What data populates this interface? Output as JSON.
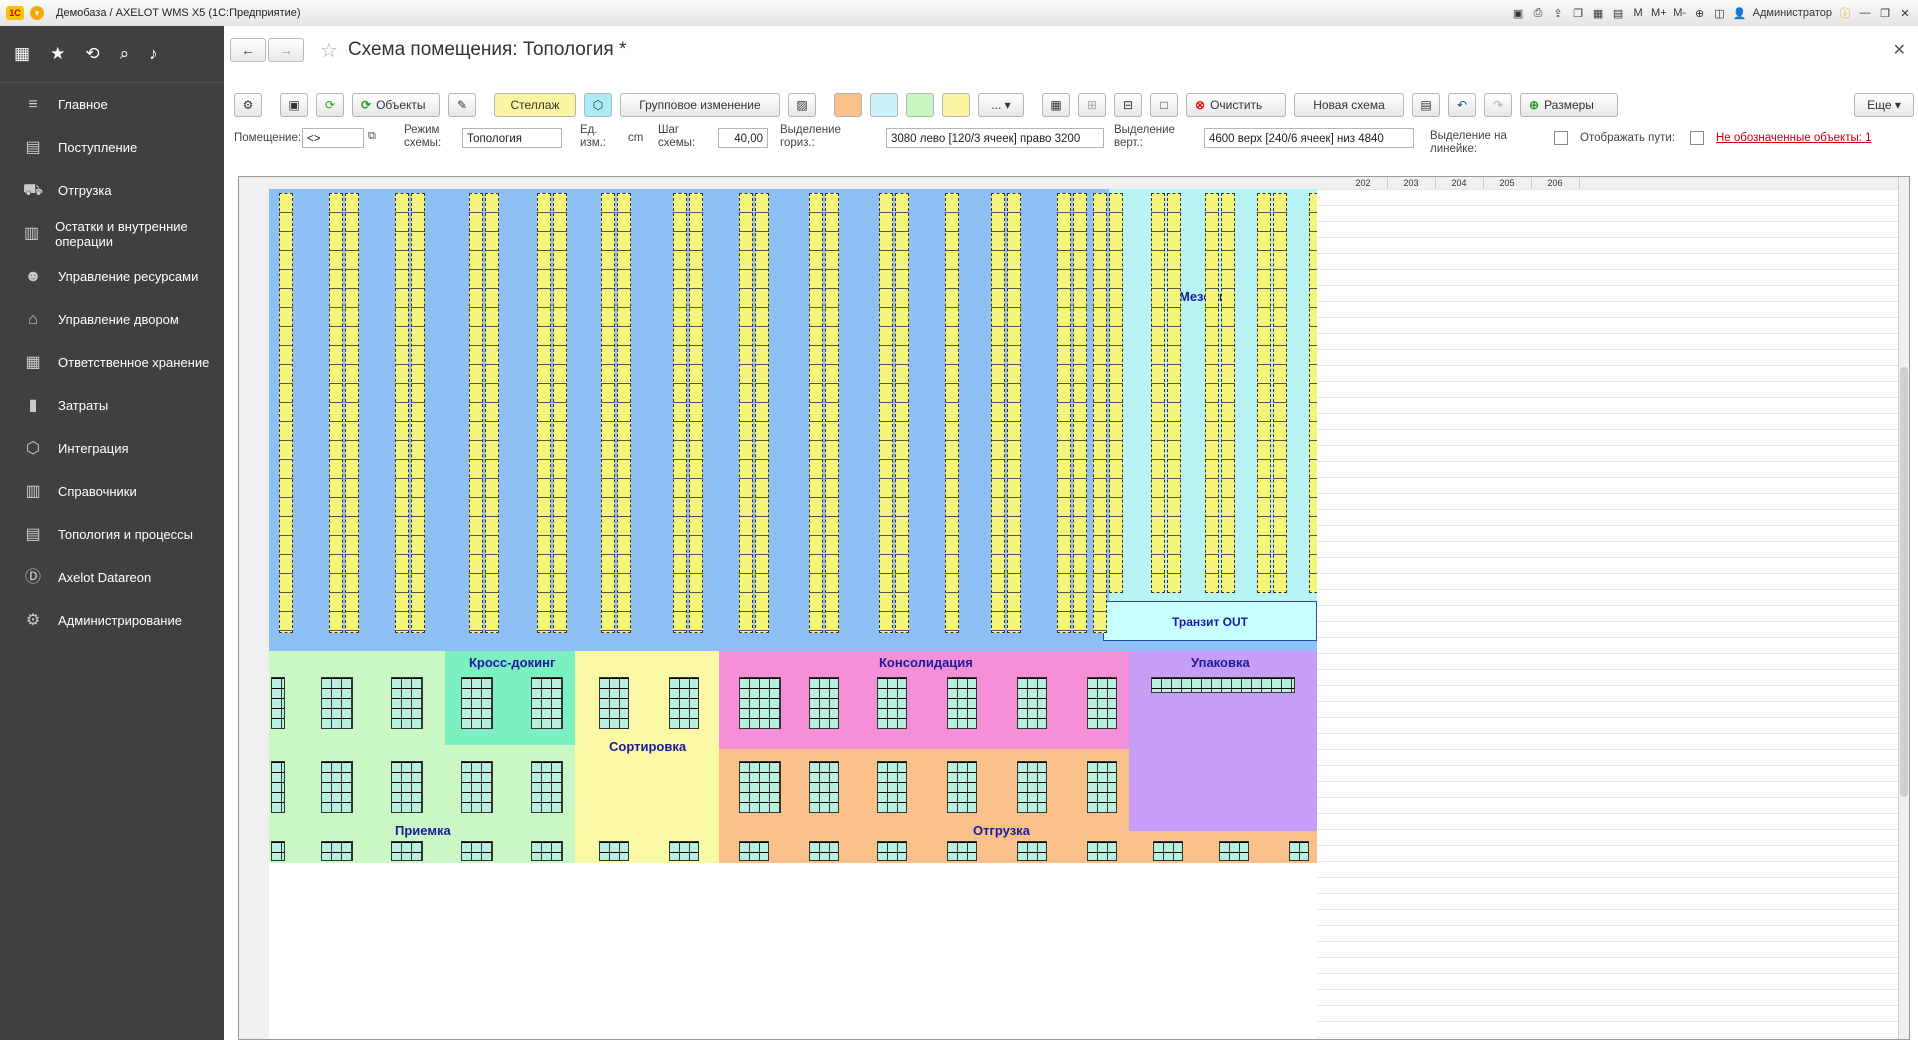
{
  "window": {
    "title": "Демобаза / AXELOT WMS X5  (1С:Предприятие)",
    "user": "Администратор",
    "m_label": "M",
    "mplus_label": "M+",
    "mminus_label": "M-"
  },
  "sidebar": {
    "items": [
      {
        "label": "Главное",
        "icon": "menu-lines-icon"
      },
      {
        "label": "Поступление",
        "icon": "inbox-icon"
      },
      {
        "label": "Отгрузка",
        "icon": "truck-icon"
      },
      {
        "label": "Остатки и внутренние операции",
        "icon": "stack-icon"
      },
      {
        "label": "Управление ресурсами",
        "icon": "person-icon"
      },
      {
        "label": "Управление двором",
        "icon": "warehouse-icon"
      },
      {
        "label": "Ответственное хранение",
        "icon": "boxes-icon"
      },
      {
        "label": "Затраты",
        "icon": "bar-chart-icon"
      },
      {
        "label": "Интеграция",
        "icon": "integration-icon"
      },
      {
        "label": "Справочники",
        "icon": "books-icon"
      },
      {
        "label": "Топология и процессы",
        "icon": "topology-icon"
      },
      {
        "label": "Axelot Datareon",
        "icon": "datareon-icon"
      },
      {
        "label": "Администрирование",
        "icon": "gear-icon"
      }
    ]
  },
  "page": {
    "title": "Схема помещения: Топология *"
  },
  "toolbar": {
    "objects_label": "Объекты",
    "rack_label": "Стеллаж",
    "group_change_label": "Групповое изменение",
    "more_dots_label": "...",
    "clear_label": "Очистить",
    "new_schema_label": "Новая схема",
    "sizes_label": "Размеры",
    "more_label": "Еще",
    "swatches": [
      "#f9c08a",
      "#c9f2f9",
      "#c9f5c0",
      "#f9f5a0"
    ]
  },
  "params": {
    "room_label": "Помещение:",
    "room_value": "<>",
    "mode_label": "Режим схемы:",
    "mode_value": "Топология",
    "unit_label": "Ед. изм.:",
    "unit_value": "cm",
    "step_label": "Шаг схемы:",
    "step_value": "40,00",
    "hsel_label": "Выделение гориз.:",
    "hsel_value": "3080 лево [120/3 ячеек]  право 3200",
    "vsel_label": "Выделение верт.:",
    "vsel_value": "4600 верх [240/6 ячеек]  низ 4840",
    "ruler_sel_label": "Выделение на линейке:",
    "show_paths_label": "Отображать пути:",
    "unmarked_link": "Не обозначенные объекты: 1"
  },
  "schema": {
    "right_columns": [
      "202",
      "203",
      "204",
      "205",
      "206"
    ],
    "zones": {
      "mezzanine": "Мезонин",
      "transit_out": "Транзит OUT",
      "cross_docking": "Кросс-докинг",
      "consolidation": "Консолидация",
      "packing": "Упаковка",
      "sorting": "Сортировка",
      "receiving": "Приемка",
      "shipping": "Отгрузка"
    },
    "colors": {
      "aisle": "#8ec0f5",
      "receiving": "#c9f8c5",
      "cross_docking": "#7cf0c0",
      "sorting": "#f9f9a5",
      "consolidation": "#f58fd8",
      "shipping": "#f9c08a",
      "packing": "#c69ef5",
      "mezzanine": "#b8f4f4",
      "rack": "#f5f57a"
    }
  }
}
